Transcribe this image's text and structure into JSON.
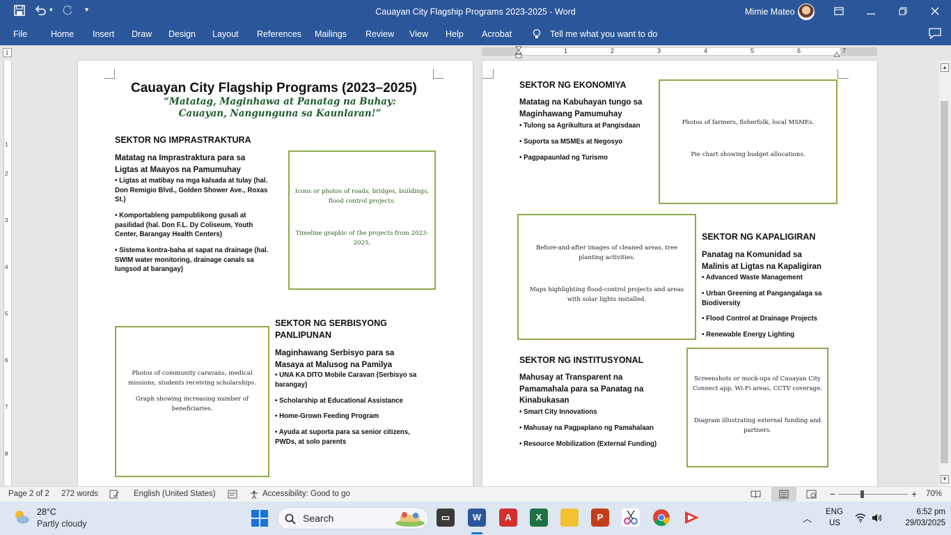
{
  "window": {
    "title": "Cauayan City Flagship Programs 2023-2025  -  Word",
    "user": "Mimie Mateo"
  },
  "ribbon_tabs": [
    "File",
    "Home",
    "Insert",
    "Draw",
    "Design",
    "Layout",
    "References",
    "Mailings",
    "Review",
    "View",
    "Help",
    "Acrobat"
  ],
  "tell_me": "Tell me what you want to do",
  "ruler_numbers": [
    "1",
    "2",
    "3",
    "4",
    "5",
    "6",
    "7"
  ],
  "vruler_numbers": [
    "1",
    "2",
    "3",
    "4",
    "5",
    "6",
    "7",
    "8"
  ],
  "page1": {
    "title": "Cauayan City Flagship Programs (2023–2025)",
    "motto_line1": "“Matatag, Maginhawa at Panatag na Buhay:",
    "motto_line2": "Cauayan, Nangunguna sa Kaunlaran!”",
    "infra": {
      "heading": "SEKTOR NG IMPRASTRAKTURA",
      "sub_line1": "Matatag na Imprastraktura para sa",
      "sub_line2": "Ligtas at Maayos na Pamumuhay",
      "b1_line1": "• Ligtas at matibay na mga kalsada at tulay (hal.",
      "b1_line2": "Don Remigio Blvd., Golden Shower Ave., Roxas",
      "b1_line3": "St.)",
      "b2_line1": "• Komportableng pampublikong gusali at",
      "b2_line2": "pasilidad (hal. Don F.L. Dy Coliseum, Youth",
      "b2_line3": "Center, Barangay Health Centers)",
      "b3_line1": "• Sistema kontra-baha at sapat na drainage (hal.",
      "b3_line2": "SWIM water monitoring, drainage canals sa",
      "b3_line3": "lungsod at barangay)",
      "frame_text1": "Icons or photos of roads, bridges, buildings, flood control projects.",
      "frame_text2": "Timeline graphic of the projects from 2023-2025."
    },
    "social": {
      "heading_line1": "SEKTOR NG SERBISYONG",
      "heading_line2": "PANLIPUNAN",
      "sub_line1": "Maginhawang Serbisyo para sa",
      "sub_line2": "Masaya at Malusog na Pamilya",
      "b1_line1": "• UNA KA DITO Mobile Caravan (Serbisyo sa",
      "b1_line2": "barangay)",
      "b2": "• Scholarship at Educational Assistance",
      "b3": "• Home-Grown Feeding Program",
      "b4_line1": "• Ayuda at suporta para sa senior citizens,",
      "b4_line2": "PWDs, at solo parents",
      "frame_text1": "Photos of community caravans, medical missions, students receiving scholarships.",
      "frame_text2": "Graph showing increasing number of beneficiaries."
    }
  },
  "page2": {
    "econ": {
      "heading": "SEKTOR NG EKONOMIYA",
      "sub_line1": "Matatag na Kabuhayan tungo sa",
      "sub_line2": "Maginhawang Pamumuhay",
      "b1": "• Tulong sa Agrikultura at Pangisdaan",
      "b2": "• Suporta sa MSMEs at Negosyo",
      "b3": "• Pagpapaunlad ng Turismo",
      "frame_text1": "Photos of farmers, fisherfolk, local MSMEs.",
      "frame_text2": "Pie chart showing budget allocations."
    },
    "env": {
      "heading": "SEKTOR NG KAPALIGIRAN",
      "sub_line1": "Panatag na Komunidad sa",
      "sub_line2": "Malinis at Ligtas na Kapaligiran",
      "b1": "• Advanced Waste Management",
      "b2_line1": "• Urban Greening at Pangangalaga sa",
      "b2_line2": "Biodiversity",
      "b3": "• Flood Control at Drainage Projects",
      "b4": "• Renewable Energy Lighting",
      "frame_text1": "Before-and-after images of cleaned areas, tree planting activities.",
      "frame_text2": "Maps highlighting flood-control projects and areas with solar lights installed."
    },
    "inst": {
      "heading": "SEKTOR NG INSTITUSYONAL",
      "sub_line1": "Mahusay at Transparent na",
      "sub_line2": "Pamamahala para sa Panatag na",
      "sub_line3": "Kinabukasan",
      "b1": "• Smart City Innovations",
      "b2": "• Mahusay na Pagpaplano ng Pamahalaan",
      "b3": "• Resource Mobilization (External Funding)",
      "frame_text1": "Screenshots or mock-ups of Cauayan City Connect app, Wi-Fi areas, CCTV coverage.",
      "frame_text2": "Diagram illustrating external funding and partners."
    }
  },
  "status": {
    "page": "Page 2 of 2",
    "words": "272 words",
    "language": "English (United States)",
    "accessibility": "Accessibility: Good to go",
    "zoom": "70%",
    "zoom_minus": "−",
    "zoom_plus": "+"
  },
  "taskbar": {
    "temp": "28°C",
    "weather": "Partly cloudy",
    "search": "Search",
    "lang1": "ENG",
    "lang2": "US",
    "time": "6:52 pm",
    "date": "29/03/2025"
  },
  "colors": {
    "word_blue": "#2b579a",
    "frame_green": "#8ea94a",
    "motto_green": "#1e5c2e"
  }
}
